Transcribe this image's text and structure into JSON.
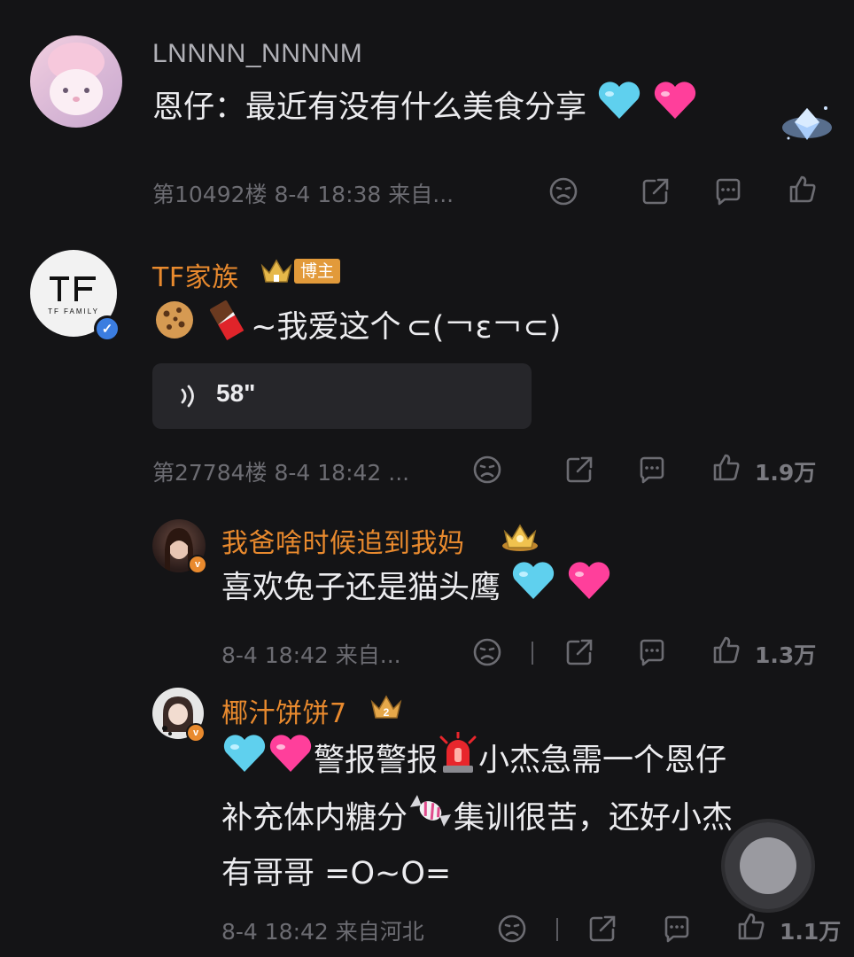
{
  "comments": [
    {
      "username": "LNNNN_NNNNM",
      "text": "恩仔：最近有没有什么美食分享",
      "meta": "第10492楼 8-4 18:38 来自..."
    },
    {
      "username": "TF家族",
      "user_badge": "博主",
      "text": "~我爱这个",
      "kaomoji": "⊂(￢ε￢⊂)",
      "voice_duration": "58\"",
      "meta": "第27784楼 8-4 18:42 ...",
      "likes": "1.9万",
      "avatar_text": "TF FAMILY"
    }
  ],
  "replies": [
    {
      "username": "我爸啥时候追到我妈",
      "text": "喜欢兔子还是猫头鹰",
      "meta": "8-4 18:42 来自...",
      "likes": "1.3万"
    },
    {
      "username": "椰汁饼饼7",
      "line1": "警报警报",
      "line1b": "小杰急需一个恩仔",
      "line2a": "补充体内糖分",
      "line2b": "集训很苦，还好小杰",
      "line3": "有哥哥 =O~O=",
      "meta": "8-4 18:42 来自河北",
      "likes": "1.1万"
    }
  ],
  "colors": {
    "username_gray": "#b0b0b6",
    "username_orange": "#e98a2e",
    "background": "#141416",
    "verified_blue": "#3b7de0",
    "verified_orange": "#e98a2e"
  }
}
